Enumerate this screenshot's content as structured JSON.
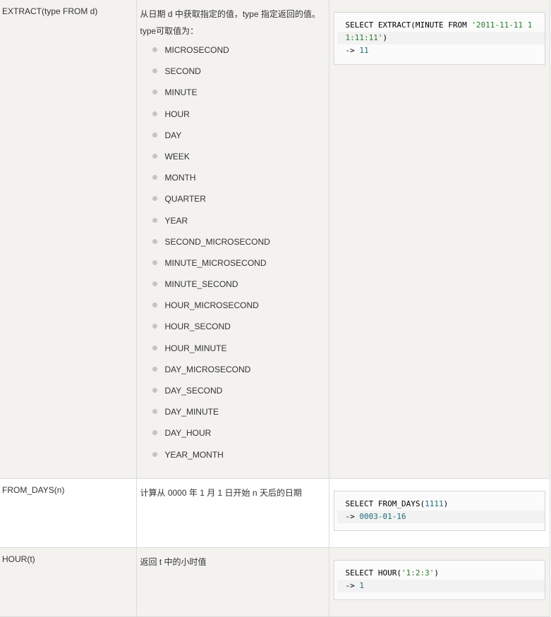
{
  "rows": [
    {
      "name": "EXTRACT(type FROM d)",
      "desc_line1": "从日期 d 中获取指定的值，type 指定返回的值。",
      "desc_line2": "type可取值为：",
      "types": [
        "MICROSECOND",
        "SECOND",
        "MINUTE",
        "HOUR",
        "DAY",
        "WEEK",
        "MONTH",
        "QUARTER",
        "YEAR",
        "SECOND_MICROSECOND",
        "MINUTE_MICROSECOND",
        "MINUTE_SECOND",
        "HOUR_MICROSECOND",
        "HOUR_SECOND",
        "HOUR_MINUTE",
        "DAY_MICROSECOND",
        "DAY_SECOND",
        "DAY_MINUTE",
        "DAY_HOUR",
        "YEAR_MONTH"
      ],
      "code": {
        "l1_kw": "SELECT EXTRACT(MINUTE FROM ",
        "l1_str": "'2011-11-11 1",
        "l2_str": "1:11:11'",
        "l2_end": ")",
        "l3_arrow": "-> ",
        "l3_val": "11"
      }
    },
    {
      "name": "FROM_DAYS(n)",
      "desc": "计算从 0000 年 1 月 1 日开始 n 天后的日期",
      "code": {
        "l1_kw": "SELECT FROM_DAYS(",
        "l1_num": "1111",
        "l1_end": ")",
        "l2_arrow": "-> ",
        "l2_val": "0003-01-16"
      }
    },
    {
      "name": "HOUR(t)",
      "desc": "返回 t 中的小时值",
      "code": {
        "l1_kw": "SELECT HOUR(",
        "l1_str": "'1:2:3'",
        "l1_end": ")",
        "l2_arrow": "-> ",
        "l2_val": "1"
      }
    }
  ]
}
